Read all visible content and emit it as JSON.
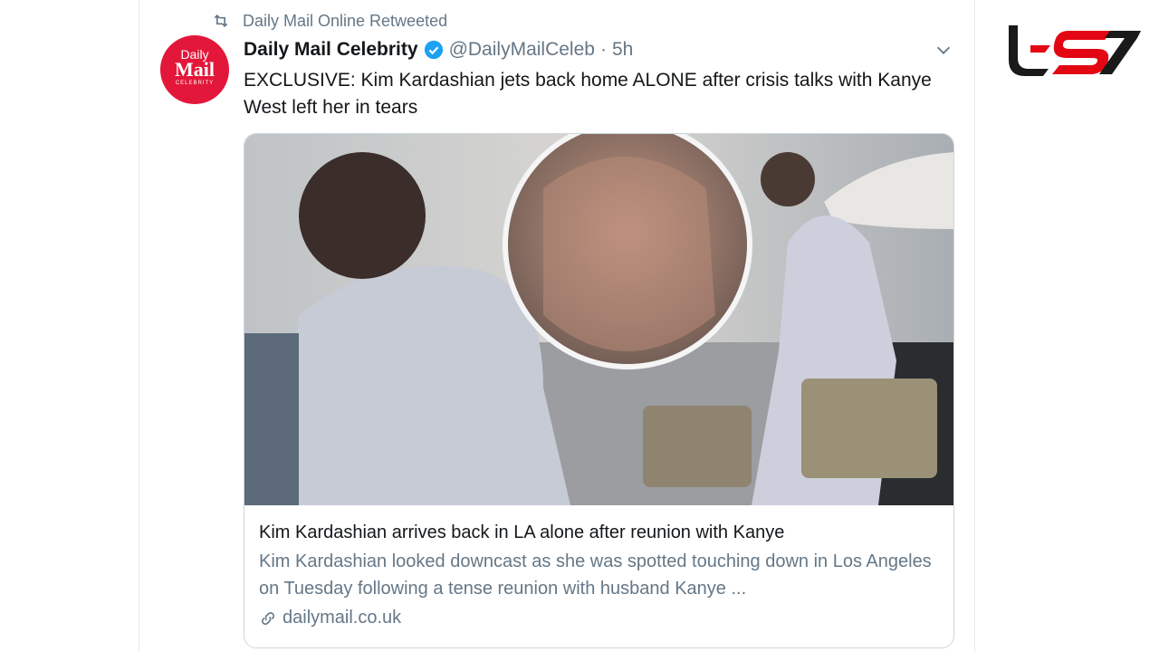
{
  "retweet": {
    "icon": "retweet-icon",
    "text": "Daily Mail Online Retweeted"
  },
  "author": {
    "avatar_line1": "Daily",
    "avatar_line2": "Mail",
    "avatar_line3": "CELEBRITY",
    "name": "Daily Mail Celebrity",
    "handle": "@DailyMailCeleb",
    "separator": "·",
    "time": "5h"
  },
  "tweet": {
    "text": "EXCLUSIVE: Kim Kardashian jets back home ALONE after crisis talks with Kanye West left her in tears"
  },
  "card": {
    "title": "Kim Kardashian arrives back in LA alone after reunion with Kanye",
    "description": "Kim Kardashian looked downcast as she was spotted touching down in Los Angeles on Tuesday following a tense reunion with husband Kanye ...",
    "domain": "dailymail.co.uk"
  },
  "colors": {
    "accent": "#1da1f2",
    "brand_red": "#e3173a",
    "muted": "#657786",
    "logo_red": "#e30613"
  }
}
